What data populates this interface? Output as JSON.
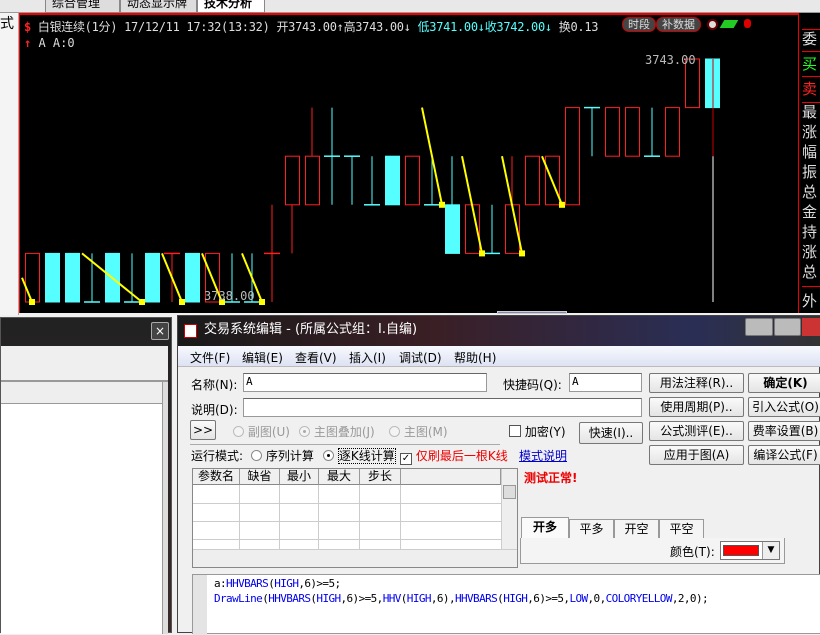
{
  "top_tabs": {
    "left_label": "式",
    "tabs": [
      "综合管理",
      "动态显示牌",
      "技术分析"
    ]
  },
  "chart_header": {
    "icon": "$",
    "instrument": "白银连续(1分)",
    "datetime": "17/12/11 17:32(13:32)",
    "open": "开3743.00↑",
    "high": "高3743.00↓",
    "low": "低3741.00↓",
    "close": "收3742.00↓",
    "turnover": "换0.13",
    "btn_period": "时段",
    "btn_supplement": "补数据",
    "indicator_line": "A A:0",
    "indicator_arrow": "↑"
  },
  "right_panel": {
    "items": [
      "委",
      "买",
      "卖",
      "最",
      "涨",
      "幅",
      "振",
      "总",
      "金",
      "持",
      "涨",
      "总",
      "外"
    ]
  },
  "colors": {
    "up": "#ff2020",
    "down": "#55ffff",
    "drawline": "#ffff00",
    "bg": "#000000"
  },
  "chart_data": {
    "type": "candlestick",
    "ylim": [
      3737.5,
      3743.2
    ],
    "label_low": "3738.00",
    "label_high": "3743.00",
    "candles": [
      {
        "o": 3738,
        "h": 3739,
        "l": 3738,
        "c": 3739
      },
      {
        "o": 3739,
        "h": 3739,
        "l": 3738,
        "c": 3738
      },
      {
        "o": 3739,
        "h": 3739,
        "l": 3738,
        "c": 3738
      },
      {
        "o": 3738,
        "h": 3739,
        "l": 3738,
        "c": 3738,
        "d": 1
      },
      {
        "o": 3739,
        "h": 3739,
        "l": 3738,
        "c": 3738
      },
      {
        "o": 3738,
        "h": 3739,
        "l": 3738,
        "c": 3738,
        "d": 1
      },
      {
        "o": 3739,
        "h": 3739,
        "l": 3738,
        "c": 3738
      },
      {
        "o": 3739,
        "h": 3739,
        "l": 3738,
        "c": 3739
      },
      {
        "o": 3739,
        "h": 3739,
        "l": 3738,
        "c": 3738
      },
      {
        "o": 3738,
        "h": 3739,
        "l": 3738,
        "c": 3739
      },
      {
        "o": 3738,
        "h": 3739,
        "l": 3738,
        "c": 3738,
        "d": 1
      },
      {
        "o": 3738,
        "h": 3739,
        "l": 3738,
        "c": 3738,
        "d": 1
      },
      {
        "o": 3739,
        "h": 3740,
        "l": 3738,
        "c": 3739
      },
      {
        "o": 3740,
        "h": 3741,
        "l": 3739,
        "c": 3741
      },
      {
        "o": 3740,
        "h": 3742,
        "l": 3740,
        "c": 3741
      },
      {
        "o": 3741,
        "h": 3742,
        "l": 3740,
        "c": 3741,
        "d": 1
      },
      {
        "o": 3741,
        "h": 3741,
        "l": 3740,
        "c": 3741,
        "d": 1
      },
      {
        "o": 3740,
        "h": 3741,
        "l": 3740,
        "c": 3740,
        "d": 1
      },
      {
        "o": 3741,
        "h": 3741,
        "l": 3740,
        "c": 3740
      },
      {
        "o": 3740,
        "h": 3741,
        "l": 3740,
        "c": 3741
      },
      {
        "o": 3740,
        "h": 3741,
        "l": 3740,
        "c": 3740,
        "d": 1
      },
      {
        "o": 3740,
        "h": 3741,
        "l": 3739,
        "c": 3739
      },
      {
        "o": 3739,
        "h": 3740,
        "l": 3739,
        "c": 3740
      },
      {
        "o": 3739,
        "h": 3740,
        "l": 3739,
        "c": 3739,
        "d": 1
      },
      {
        "o": 3739,
        "h": 3741,
        "l": 3739,
        "c": 3740
      },
      {
        "o": 3740,
        "h": 3741,
        "l": 3740,
        "c": 3741
      },
      {
        "o": 3740,
        "h": 3741,
        "l": 3740,
        "c": 3741
      },
      {
        "o": 3740,
        "h": 3742,
        "l": 3740,
        "c": 3742
      },
      {
        "o": 3742,
        "h": 3742,
        "l": 3741,
        "c": 3742,
        "d": 1
      },
      {
        "o": 3741,
        "h": 3742,
        "l": 3741,
        "c": 3742
      },
      {
        "o": 3741,
        "h": 3742,
        "l": 3741,
        "c": 3742
      },
      {
        "o": 3741,
        "h": 3742,
        "l": 3741,
        "c": 3741,
        "d": 1
      },
      {
        "o": 3741,
        "h": 3742,
        "l": 3741,
        "c": 3742
      },
      {
        "o": 3742,
        "h": 3743,
        "l": 3742,
        "c": 3743
      },
      {
        "o": 3743,
        "h": 3743,
        "l": 3742,
        "c": 3742
      }
    ],
    "drawlines": [
      [
        -0.5,
        3738.5,
        0,
        3738
      ],
      [
        2.5,
        3739,
        5.5,
        3738
      ],
      [
        6.5,
        3739,
        7.5,
        3738
      ],
      [
        8.5,
        3739,
        9.5,
        3738
      ],
      [
        10.5,
        3739,
        11.5,
        3738
      ],
      [
        19.5,
        3742,
        20.5,
        3740
      ],
      [
        21.5,
        3741,
        22.5,
        3739
      ],
      [
        23.5,
        3741,
        24.5,
        3739
      ],
      [
        25.5,
        3741,
        26.5,
        3740
      ]
    ]
  },
  "left_panel": {
    "close": "×"
  },
  "dialog": {
    "title": "交易系统编辑 - (所属公式组：I.自编)",
    "menu": [
      "文件(F)",
      "编辑(E)",
      "查看(V)",
      "插入(I)",
      "调试(D)",
      "帮助(H)"
    ],
    "name_label": "名称(N):",
    "name_value": "A",
    "shortcut_label": "快捷码(Q):",
    "shortcut_value": "A",
    "desc_label": "说明(D):",
    "desc_value": "",
    "expand": ">>",
    "radio_sub": "副图(U)",
    "radio_overlay": "主图叠加(J)",
    "radio_main": "主图(M)",
    "encrypt": "加密(Y)",
    "quick": "快速(I)..",
    "mode_label": "运行模式:",
    "mode_seq": "序列计算",
    "mode_bar": "逐K线计算",
    "last_bar": "仅刷最后一根K线",
    "mode_help": "模式说明",
    "status": "测试正常!",
    "buttons_col1": [
      "用法注释(R)..",
      "使用周期(P)..",
      "公式测评(E)..",
      "应用于图(A)"
    ],
    "buttons_col2": [
      "确定(K)",
      "引入公式(O)",
      "费率设置(B)",
      "编译公式(F)"
    ],
    "param_headers": [
      "参数名",
      "缺省",
      "最小",
      "最大",
      "步长",
      ""
    ],
    "signal_tabs": [
      "开多",
      "平多",
      "开空",
      "平空"
    ],
    "color_label": "颜色(T):",
    "color_value": "#ff0000",
    "code_lines": [
      [
        {
          "t": "a:",
          "c": "n"
        },
        {
          "t": "HHVBARS",
          "c": "k"
        },
        {
          "t": "(",
          "c": "n"
        },
        {
          "t": "HIGH",
          "c": "k"
        },
        {
          "t": ",6)>=5;",
          "c": "n"
        }
      ],
      [
        {
          "t": "DrawLine",
          "c": "k"
        },
        {
          "t": "(",
          "c": "n"
        },
        {
          "t": "HHVBARS",
          "c": "k"
        },
        {
          "t": "(",
          "c": "n"
        },
        {
          "t": "HIGH",
          "c": "k"
        },
        {
          "t": ",6)>=5,",
          "c": "n"
        },
        {
          "t": "HHV",
          "c": "k"
        },
        {
          "t": "(",
          "c": "n"
        },
        {
          "t": "HIGH",
          "c": "k"
        },
        {
          "t": ",6),",
          "c": "n"
        },
        {
          "t": "HHVBARS",
          "c": "k"
        },
        {
          "t": "(",
          "c": "n"
        },
        {
          "t": "HIGH",
          "c": "k"
        },
        {
          "t": ",6)>=5,",
          "c": "n"
        },
        {
          "t": "LOW",
          "c": "k"
        },
        {
          "t": ",0,",
          "c": "n"
        },
        {
          "t": "COLORYELLOW",
          "c": "k"
        },
        {
          "t": ",2,0);",
          "c": "n"
        }
      ]
    ]
  }
}
